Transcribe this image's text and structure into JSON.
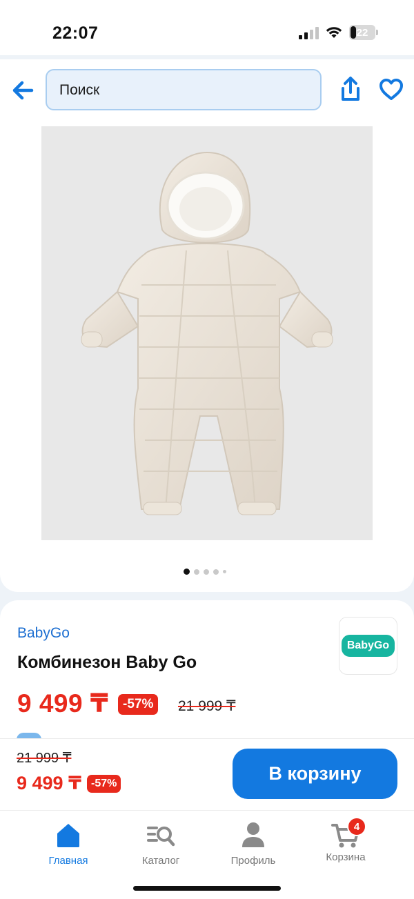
{
  "status_bar": {
    "time": "22:07",
    "battery": "22"
  },
  "header": {
    "search_placeholder": "Поиск",
    "icons": [
      "back-arrow-icon",
      "share-icon",
      "heart-icon"
    ]
  },
  "gallery": {
    "total_images": 5,
    "active_index": 0,
    "image_subject": "cream winter puffer jumpsuit with hood"
  },
  "product": {
    "brand": "BabyGo",
    "brand_logo_text": "BabyGo",
    "title": "Комбинезон Baby Go",
    "price": "9 499 ₸",
    "discount": "-57%",
    "old_price": "21 999 ₸"
  },
  "buy_bar": {
    "old_price": "21 999 ₸",
    "price": "9 499 ₸",
    "discount": "-57%",
    "cart_button": "В корзину"
  },
  "tabs": [
    {
      "label": "Главная",
      "icon": "home-icon",
      "active": true
    },
    {
      "label": "Каталог",
      "icon": "catalog-search-icon",
      "active": false
    },
    {
      "label": "Профиль",
      "icon": "profile-icon",
      "active": false
    },
    {
      "label": "Корзина",
      "icon": "cart-icon",
      "active": false,
      "badge": "4"
    }
  ],
  "colors": {
    "accent": "#1379e0",
    "price": "#e8291c",
    "brand_logo": "#17b5a0"
  }
}
